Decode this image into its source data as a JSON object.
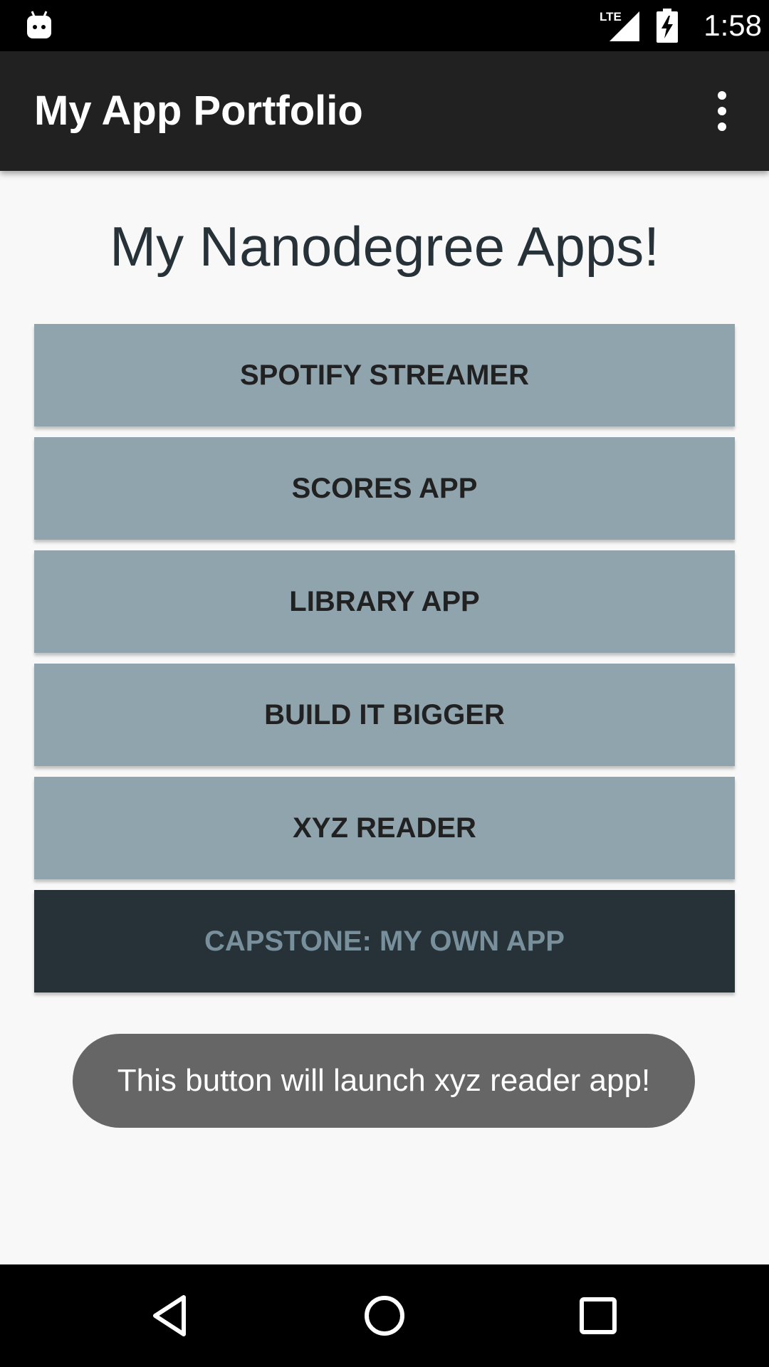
{
  "status_bar": {
    "time": "1:58",
    "network": "LTE",
    "icons": [
      "android-notification-icon",
      "lte-signal-icon",
      "battery-charging-icon"
    ]
  },
  "app_bar": {
    "title": "My App Portfolio",
    "menu_icon": "overflow-menu-icon"
  },
  "main": {
    "heading": "My Nanodegree Apps!",
    "buttons": [
      {
        "label": "SPOTIFY STREAMER"
      },
      {
        "label": "SCORES APP"
      },
      {
        "label": "LIBRARY APP"
      },
      {
        "label": "BUILD IT BIGGER"
      },
      {
        "label": "XYZ READER"
      },
      {
        "label": "CAPSTONE: MY OWN APP"
      }
    ]
  },
  "toast": {
    "message": "This button will launch xyz reader app!"
  },
  "nav_bar": {
    "icons": [
      "back-icon",
      "home-icon",
      "recents-icon"
    ]
  },
  "colors": {
    "app_bar": "#212121",
    "button": "#90a4ae",
    "button_dark": "#263238",
    "button_dark_text": "#78909c",
    "heading_text": "#263238",
    "toast": "#666666",
    "background": "#f8f8f8"
  }
}
